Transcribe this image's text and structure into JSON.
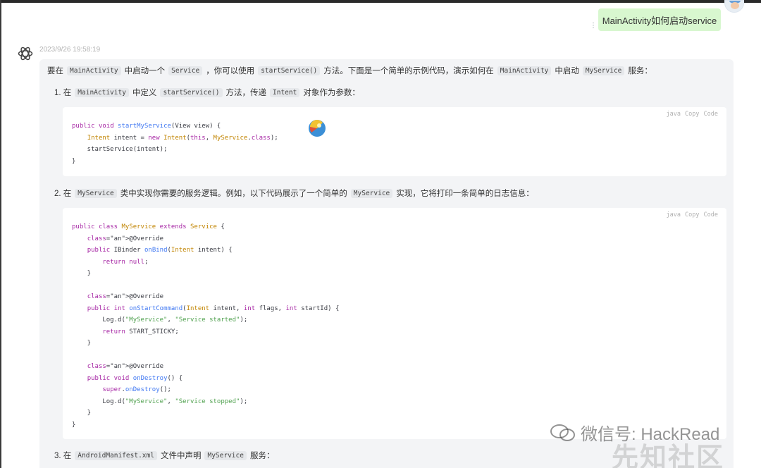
{
  "user_message": {
    "text": "MainActivity如何启动service",
    "menu_icon": "vertical-dots"
  },
  "assistant": {
    "timestamp": "2023/9/26 19:58:19",
    "intro": {
      "t1": "要在",
      "c1": "MainActivity",
      "t2": "中启动一个",
      "c2": "Service",
      "t3": "，你可以使用",
      "c3": "startService()",
      "t4": "方法。下面是一个简单的示例代码，演示如何在",
      "c4": "MainActivity",
      "t5": "中启动",
      "c5": "MyService",
      "t6": "服务："
    },
    "step1": {
      "num": "1. 在",
      "c1": "MainActivity",
      "t1": "中定义",
      "c2": "startService()",
      "t2": "方法，传递",
      "c3": "Intent",
      "t3": "对象作为参数："
    },
    "step2": {
      "num": "2. 在",
      "c1": "MyService",
      "t1": "类中实现你需要的服务逻辑。例如，以下代码展示了一个简单的",
      "c2": "MyService",
      "t2": "实现，它将打印一条简单的日志信息："
    },
    "step3": {
      "num": "3. 在",
      "c1": "AndroidManifest.xml",
      "t1": "文件中声明",
      "c2": "MyService",
      "t2": "服务："
    },
    "code_toolbar": {
      "lang": "java",
      "copy": "Copy",
      "code": "Code"
    },
    "code_block_1": [
      "public void startMyService(View view) {",
      "    Intent intent = new Intent(this, MyService.class);",
      "    startService(intent);",
      "}"
    ],
    "code_block_2": [
      "public class MyService extends Service {",
      "    @Override",
      "    public IBinder onBind(Intent intent) {",
      "        return null;",
      "    }",
      "",
      "    @Override",
      "    public int onStartCommand(Intent intent, int flags, int startId) {",
      "        Log.d(\"MyService\", \"Service started\");",
      "        return START_STICKY;",
      "    }",
      "",
      "    @Override",
      "    public void onDestroy() {",
      "        super.onDestroy();",
      "        Log.d(\"MyService\", \"Service stopped\");",
      "    }",
      "}"
    ]
  },
  "watermark": {
    "wechat": "微信号: HackRead",
    "site": "先知社区"
  }
}
